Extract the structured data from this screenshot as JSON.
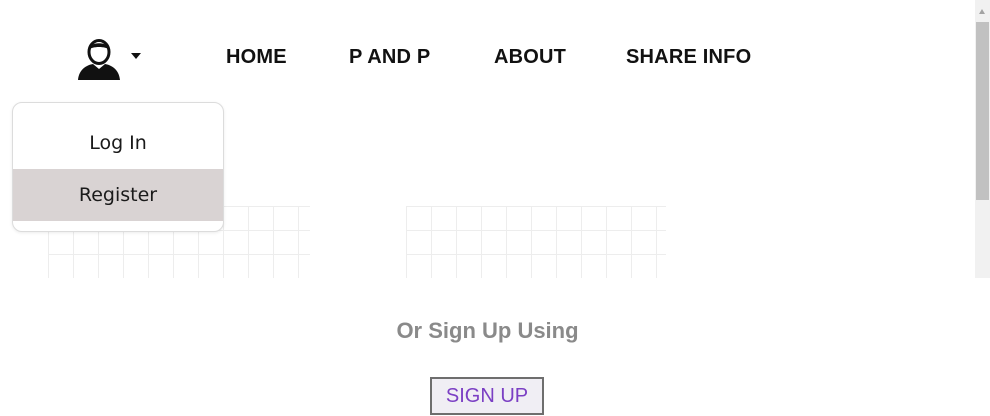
{
  "nav": {
    "links": [
      {
        "label": "HOME"
      },
      {
        "label": "P AND P"
      },
      {
        "label": "ABOUT"
      },
      {
        "label": "SHARE INFO"
      }
    ],
    "user_icon": "user-icon",
    "caret_icon": "caret-down-icon"
  },
  "dropdown": {
    "items": [
      {
        "label": "Log In"
      },
      {
        "label": "Register"
      }
    ],
    "highlight_color": "#d9d3d3"
  },
  "signup": {
    "prompt": "Or Sign Up Using",
    "button_label": "SIGN UP",
    "button_text_color": "#7b3fc4"
  }
}
